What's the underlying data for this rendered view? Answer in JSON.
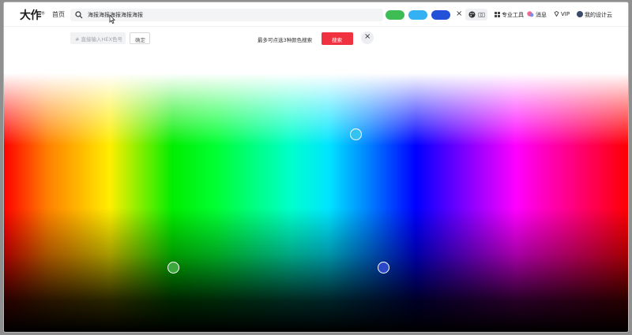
{
  "header": {
    "logo_text": "大作",
    "logo_mark": "®",
    "home": "首页",
    "search_value": "海报海报海报海报海报",
    "colors": {
      "swatch_1": "#3fbd55",
      "swatch_2": "#34b1f2",
      "swatch_3": "#2352d9"
    },
    "clear": "×",
    "links": {
      "pro_tools": "专业工具",
      "messages": "消息",
      "vip": "VIP",
      "cloud": "我的设计云"
    }
  },
  "toolbar": {
    "hex_placeholder": "# 直接输入HEX色号",
    "confirm": "确定",
    "tip": "最多可点选3种颜色搜索",
    "search": "搜索",
    "close": "×"
  },
  "palette": {
    "pickers": [
      {
        "color": "#35c2f0"
      },
      {
        "color": "#3ea83e"
      },
      {
        "color": "#2a48c8"
      }
    ]
  }
}
